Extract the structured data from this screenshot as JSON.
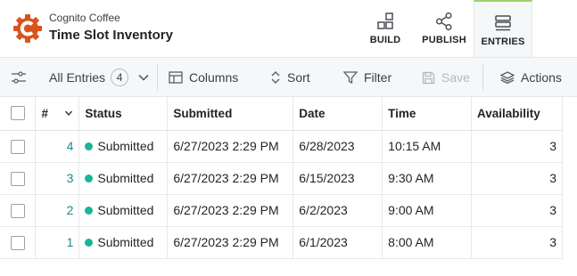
{
  "app": {
    "org": "Cognito Coffee",
    "title": "Time Slot Inventory",
    "accent": "#d9531e"
  },
  "tabs": [
    {
      "label": "BUILD",
      "icon": "build-icon"
    },
    {
      "label": "PUBLISH",
      "icon": "share-icon"
    },
    {
      "label": "ENTRIES",
      "icon": "entries-icon",
      "active": true
    }
  ],
  "toolbar": {
    "view_label": "All Entries",
    "view_count": "4",
    "columns_label": "Columns",
    "sort_label": "Sort",
    "filter_label": "Filter",
    "save_label": "Save",
    "actions_label": "Actions"
  },
  "table": {
    "headers": {
      "num": "#",
      "status": "Status",
      "submitted": "Submitted",
      "date": "Date",
      "time": "Time",
      "availability": "Availability"
    },
    "rows": [
      {
        "num": "4",
        "status": "Submitted",
        "submitted": "6/27/2023 2:29 PM",
        "date": "6/28/2023",
        "time": "10:15 AM",
        "availability": "3"
      },
      {
        "num": "3",
        "status": "Submitted",
        "submitted": "6/27/2023 2:29 PM",
        "date": "6/15/2023",
        "time": "9:30 AM",
        "availability": "3"
      },
      {
        "num": "2",
        "status": "Submitted",
        "submitted": "6/27/2023 2:29 PM",
        "date": "6/2/2023",
        "time": "9:00 AM",
        "availability": "3"
      },
      {
        "num": "1",
        "status": "Submitted",
        "submitted": "6/27/2023 2:29 PM",
        "date": "6/1/2023",
        "time": "8:00 AM",
        "availability": "3"
      }
    ],
    "status_color": "#1bb39b"
  }
}
